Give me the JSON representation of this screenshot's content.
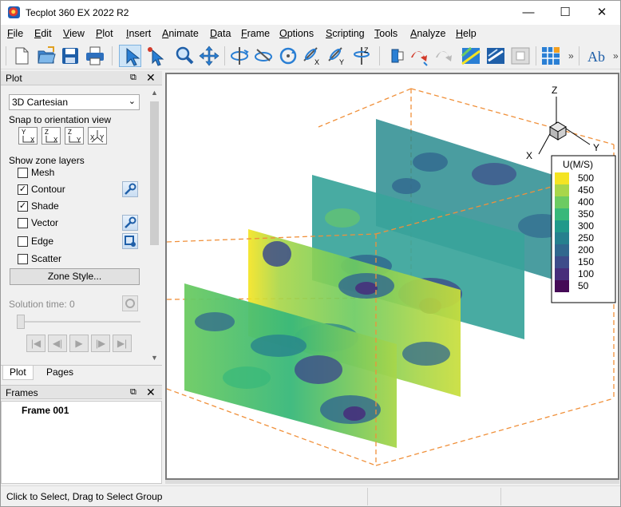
{
  "window": {
    "title": "Tecplot 360 EX 2022 R2"
  },
  "menu": [
    {
      "label": "File",
      "u": "F",
      "rest": "ile"
    },
    {
      "label": "Edit",
      "u": "E",
      "rest": "dit"
    },
    {
      "label": "View",
      "u": "V",
      "rest": "iew"
    },
    {
      "label": "Plot",
      "u": "P",
      "rest": "lot"
    },
    {
      "label": "Insert",
      "u": "I",
      "rest": "nsert"
    },
    {
      "label": "Animate",
      "u": "A",
      "rest": "nimate"
    },
    {
      "label": "Data",
      "u": "D",
      "rest": "ata"
    },
    {
      "label": "Frame",
      "u": "F",
      "rest": "rame"
    },
    {
      "label": "Options",
      "u": "O",
      "rest": "ptions"
    },
    {
      "label": "Scripting",
      "u": "S",
      "rest": "cripting"
    },
    {
      "label": "Tools",
      "u": "T",
      "rest": "ools"
    },
    {
      "label": "Analyze",
      "u": "A",
      "rest": "nalyze"
    },
    {
      "label": "Help",
      "u": "H",
      "rest": "elp"
    }
  ],
  "toolbar": {
    "overflow1": "»",
    "overflow2": "»",
    "text_tool": "Ab"
  },
  "plot_panel": {
    "title": "Plot",
    "plot_type": "3D Cartesian",
    "snap_label": "Snap to orientation view",
    "orient_views": [
      {
        "a": "Y",
        "b": "X"
      },
      {
        "a": "Z",
        "b": "X"
      },
      {
        "a": "Z",
        "b": "Y"
      },
      {
        "a": "X",
        "b": "Y"
      }
    ],
    "zone_layers_label": "Show zone layers",
    "layers": [
      {
        "label": "Mesh",
        "checked": false
      },
      {
        "label": "Contour",
        "checked": true
      },
      {
        "label": "Shade",
        "checked": true
      },
      {
        "label": "Vector",
        "checked": false
      },
      {
        "label": "Edge",
        "checked": false
      },
      {
        "label": "Scatter",
        "checked": false
      }
    ],
    "zone_style_button": "Zone Style...",
    "solution_time_label": "Solution time:",
    "solution_time_value": "0"
  },
  "tabs": {
    "plot": "Plot",
    "pages": "Pages"
  },
  "frames_panel": {
    "title": "Frames",
    "items": [
      "Frame 001"
    ]
  },
  "legend": {
    "title": "U(M/S)",
    "levels": [
      "500",
      "450",
      "400",
      "350",
      "300",
      "250",
      "200",
      "150",
      "100",
      "50"
    ],
    "colors": [
      "#f4e423",
      "#a8d64a",
      "#6ccb62",
      "#38b87a",
      "#21998a",
      "#26808e",
      "#31688e",
      "#3d4c8a",
      "#472d7b",
      "#440a56"
    ]
  },
  "axes": {
    "x": "X",
    "y": "Y",
    "z": "Z"
  },
  "status": {
    "text": "Click to Select, Drag to Select Group"
  }
}
